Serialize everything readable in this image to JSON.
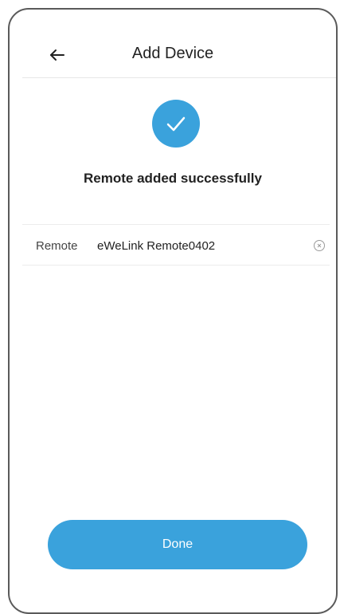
{
  "header": {
    "title": "Add Device",
    "back_icon": "arrow-left-icon"
  },
  "status": {
    "icon": "checkmark-icon",
    "message": "Remote added successfully"
  },
  "device": {
    "label": "Remote",
    "name_value": "eWeLink Remote0402",
    "clear_icon": "clear-icon"
  },
  "actions": {
    "done_label": "Done"
  },
  "colors": {
    "accent": "#3aa2dc",
    "text_primary": "#222222",
    "divider": "#e6e6e6"
  }
}
